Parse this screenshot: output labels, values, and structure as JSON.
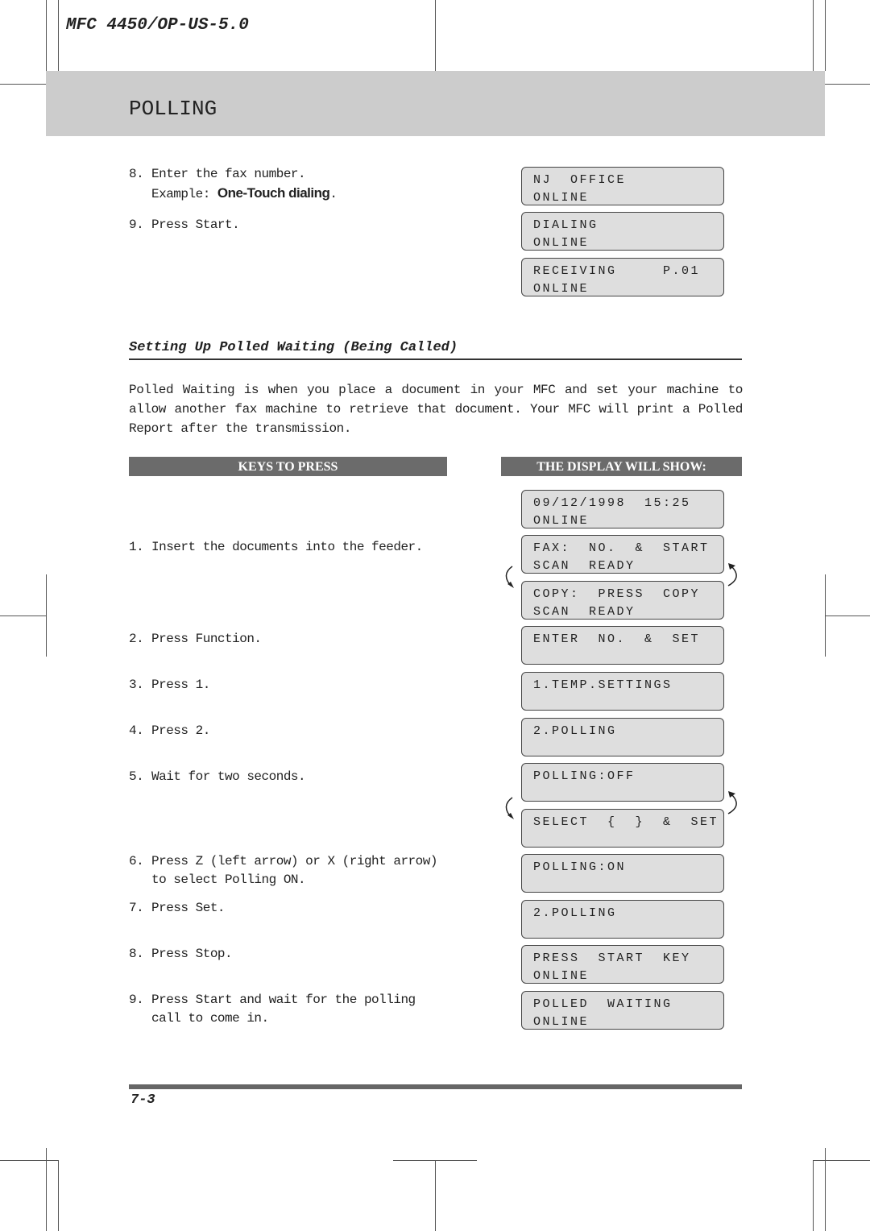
{
  "header": {
    "model": "MFC 4450/OP-US-5.0",
    "chapter_title": "POLLING"
  },
  "top_steps": [
    {
      "num": "8.",
      "text": "Enter the fax number.",
      "example_label": "Example:",
      "example_value": "One-Touch dialing",
      "example_end": "."
    },
    {
      "num": "9.",
      "text": "Press Start."
    }
  ],
  "top_displays": [
    {
      "line1": "NJ  OFFICE",
      "line2": "ONLINE"
    },
    {
      "line1": "DIALING",
      "line2": "ONLINE"
    },
    {
      "line1": "RECEIVING     P.01",
      "line2": "ONLINE"
    }
  ],
  "section": {
    "title": "Setting Up Polled Waiting (Being Called)",
    "paragraph": "Polled Waiting is when you place a document in your MFC and set your machine to allow another fax machine to retrieve that document. Your MFC will print a Polled Report after the transmission."
  },
  "columns": {
    "keys": "KEYS TO PRESS",
    "display": "THE DISPLAY WILL SHOW:"
  },
  "steps": [
    {
      "num": "1.",
      "text": "Insert the documents into the feeder."
    },
    {
      "num": "2.",
      "text": "Press Function."
    },
    {
      "num": "3.",
      "text": "Press 1."
    },
    {
      "num": "4.",
      "text": "Press 2."
    },
    {
      "num": "5.",
      "text": "Wait for two seconds."
    },
    {
      "num": "6.",
      "text": "Press Z (left arrow) or X (right arrow) to select Polling ON."
    },
    {
      "num": "7.",
      "text": "Press Set."
    },
    {
      "num": "8.",
      "text": "Press Stop."
    },
    {
      "num": "9.",
      "text": "Press Start and wait for the polling call to come in."
    }
  ],
  "displays": [
    {
      "line1": "09/12/1998  15:25",
      "line2": "ONLINE"
    },
    {
      "line1": "FAX:  NO.  &  START",
      "line2": "SCAN  READY"
    },
    {
      "line1": "COPY:  PRESS  COPY",
      "line2": "SCAN  READY"
    },
    {
      "line1": "ENTER  NO.  &  SET",
      "line2": ""
    },
    {
      "line1": "1.TEMP.SETTINGS",
      "line2": ""
    },
    {
      "line1": "2.POLLING",
      "line2": ""
    },
    {
      "line1": "POLLING:OFF",
      "line2": ""
    },
    {
      "line1": "SELECT  {  }  &  SET",
      "line2": ""
    },
    {
      "line1": "POLLING:ON",
      "line2": ""
    },
    {
      "line1": "2.POLLING",
      "line2": ""
    },
    {
      "line1": "PRESS  START  KEY",
      "line2": "ONLINE"
    },
    {
      "line1": "POLLED  WAITING",
      "line2": "ONLINE"
    }
  ],
  "footer": {
    "page": "7-3"
  },
  "colors": {
    "band": "#cccccc",
    "column_header": "#6b6b6b",
    "lcd": "#dedede"
  }
}
